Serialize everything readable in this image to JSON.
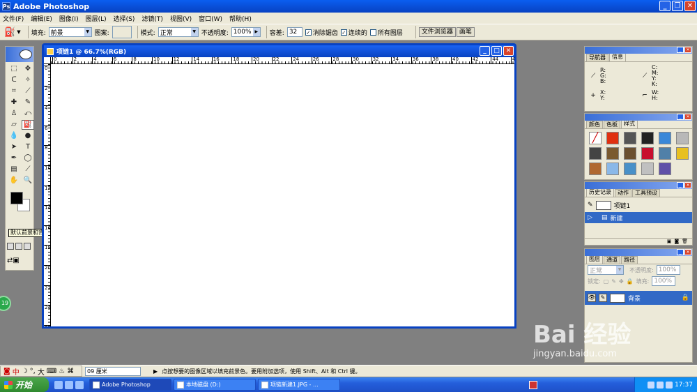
{
  "app": {
    "title": "Adobe Photoshop"
  },
  "menu": [
    "文件(F)",
    "编辑(E)",
    "图像(I)",
    "图层(L)",
    "选择(S)",
    "滤镜(T)",
    "视图(V)",
    "窗口(W)",
    "帮助(H)"
  ],
  "options": {
    "fill_label": "填充:",
    "fill_value": "前景",
    "pattern_label": "图案:",
    "mode_label": "模式:",
    "mode_value": "正常",
    "opacity_label": "不透明度:",
    "opacity_value": "100%",
    "tolerance_label": "容差:",
    "tolerance_value": "32",
    "antialias_label": "消除锯齿",
    "contiguous_label": "连续的",
    "all_layers_label": "所有图层",
    "antialias_checked": true,
    "contiguous_checked": true,
    "all_layers_checked": false,
    "well_tabs": [
      "文件浏览器",
      "画笔"
    ]
  },
  "toolbox": {
    "tooltip": "默认前景和背景色 (D)",
    "foreground_color": "#000000",
    "background_color": "#ffffff"
  },
  "document": {
    "title": "项链1 @ 66.7%(RGB)",
    "ruler_top": [
      "0",
      "2",
      "4",
      "6",
      "8",
      "10",
      "12",
      "14",
      "16",
      "18",
      "20",
      "22",
      "24",
      "26",
      "28",
      "30",
      "32",
      "34",
      "36",
      "38",
      "40",
      "42",
      "44",
      "46"
    ],
    "ruler_left": [
      "0",
      "2",
      "4",
      "6",
      "8",
      "10",
      "12",
      "14",
      "16",
      "18",
      "20",
      "22",
      "24",
      "26"
    ]
  },
  "navigator_panel": {
    "tabs": [
      "导航器",
      "信息"
    ],
    "active_tab": "信息",
    "rgb_label": "R:\nG:\nB:",
    "cmyk_label": "C:\nM:\nY:\nK:",
    "xy_label": "X:\nY:",
    "wh_label": "W:\nH:"
  },
  "color_panel": {
    "tabs": [
      "颜色",
      "色板",
      "样式"
    ],
    "active_tab": "样式",
    "swatches": [
      "#ffffff",
      "#e03010",
      "#555555",
      "#222222",
      "#3a88d8",
      "#b8b8b8",
      "#444444",
      "#7a5a30",
      "#6b5030",
      "#c8102e",
      "#5080a8",
      "#e8c020",
      "#b06830",
      "#8ab8e8",
      "#4890c8",
      "#c0c0c0",
      "#6050a8"
    ]
  },
  "history_panel": {
    "tabs": [
      "历史记录",
      "动作",
      "工具预设"
    ],
    "active_tab": "历史记录",
    "snapshot_label": "项链1",
    "items": [
      "新建"
    ]
  },
  "layers_panel": {
    "tabs": [
      "图层",
      "通道",
      "路径"
    ],
    "active_tab": "图层",
    "blend_mode": "正常",
    "opacity_label": "不透明度:",
    "opacity_value": "100%",
    "lock_label": "锁定:",
    "fill_label": "填充:",
    "fill_value": "100%",
    "layers": [
      "背景"
    ]
  },
  "status": {
    "ime_text": "中",
    "zoom_field": "09 厘米",
    "hint": "点按想要的图像区域以填充前景色。要用附加选项，使用 Shift、Alt 和 Ctrl 键。"
  },
  "taskbar": {
    "start_label": "开始",
    "tasks": [
      "Adobe Photoshop",
      "本地磁盘 (D:)",
      "项链新建1.JPG - ..."
    ],
    "clock": "17:37"
  },
  "overlay": {
    "badge": "19",
    "watermark_logo": "Bai 经验",
    "watermark_url": "jingyan.baidu.com"
  }
}
